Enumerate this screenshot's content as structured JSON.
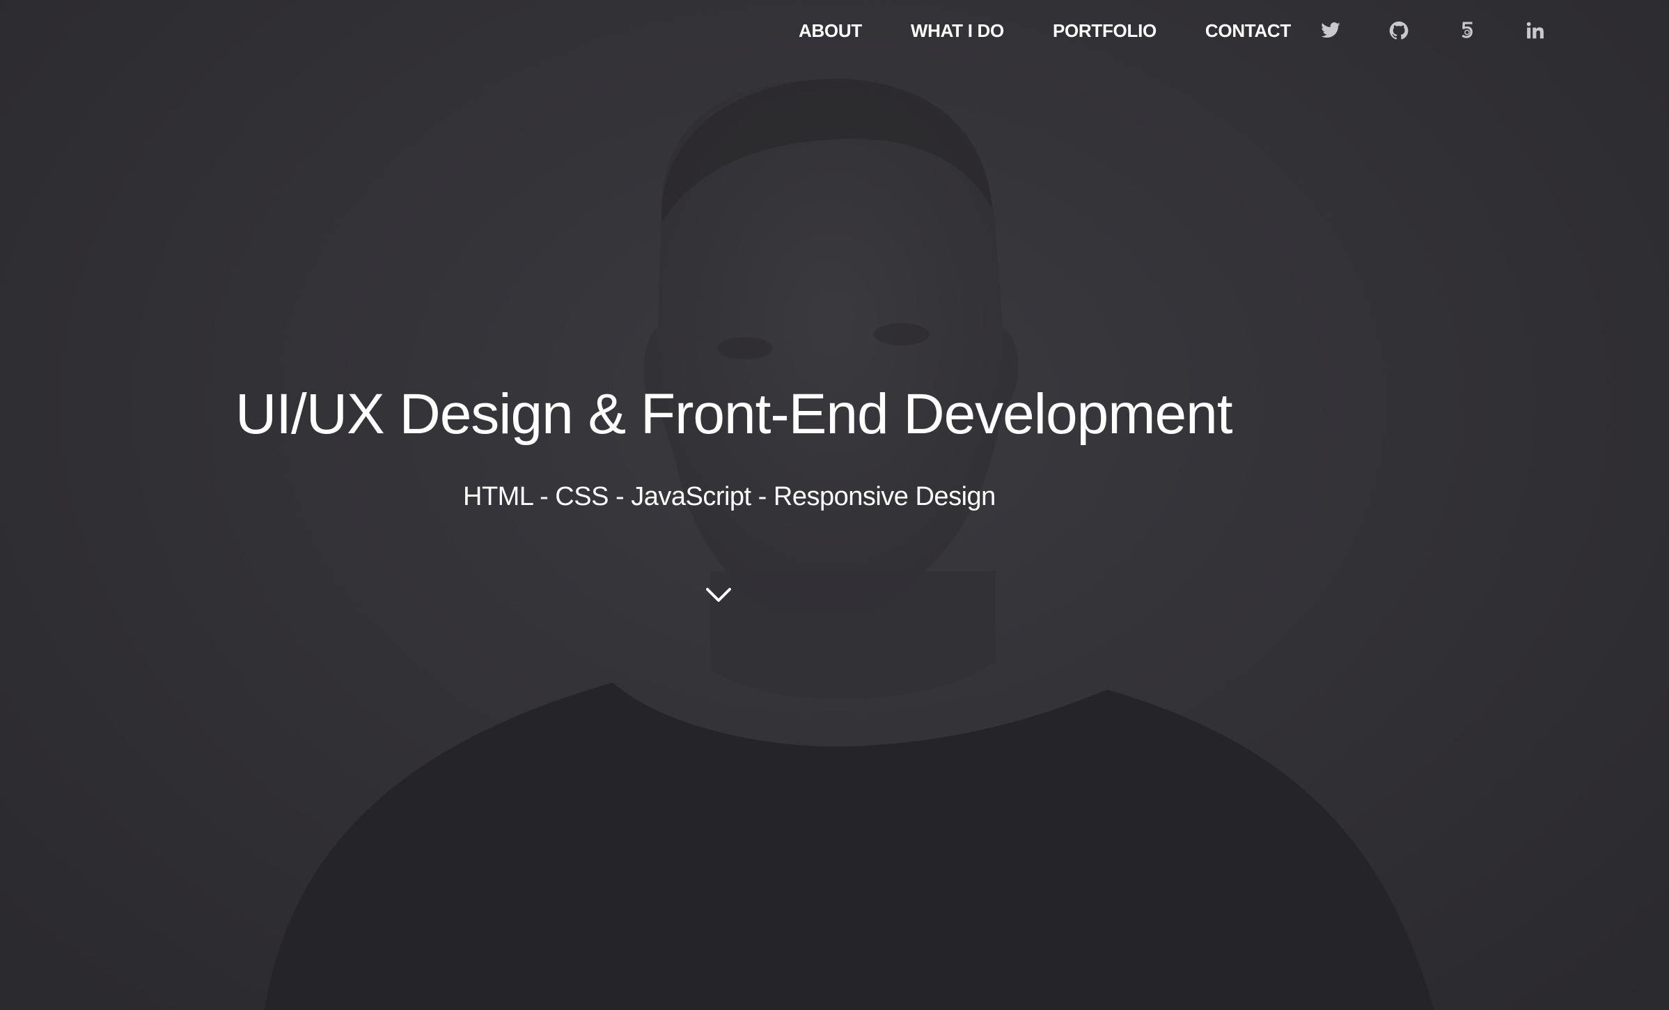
{
  "nav": {
    "items": [
      {
        "label": "ABOUT"
      },
      {
        "label": "WHAT I DO"
      },
      {
        "label": "PORTFOLIO"
      },
      {
        "label": "CONTACT"
      }
    ],
    "social": [
      {
        "icon": "twitter-icon"
      },
      {
        "icon": "github-icon"
      },
      {
        "icon": "html5-icon"
      },
      {
        "icon": "linkedin-icon"
      }
    ]
  },
  "hero": {
    "headline": "UI/UX Design & Front-End Development",
    "subline": "HTML - CSS - JavaScript - Responsive Design",
    "scroll_icon": "chevron-down-icon"
  },
  "colors": {
    "background": "#2d2c30",
    "text": "#ffffff",
    "icon": "#c9c9cc"
  }
}
